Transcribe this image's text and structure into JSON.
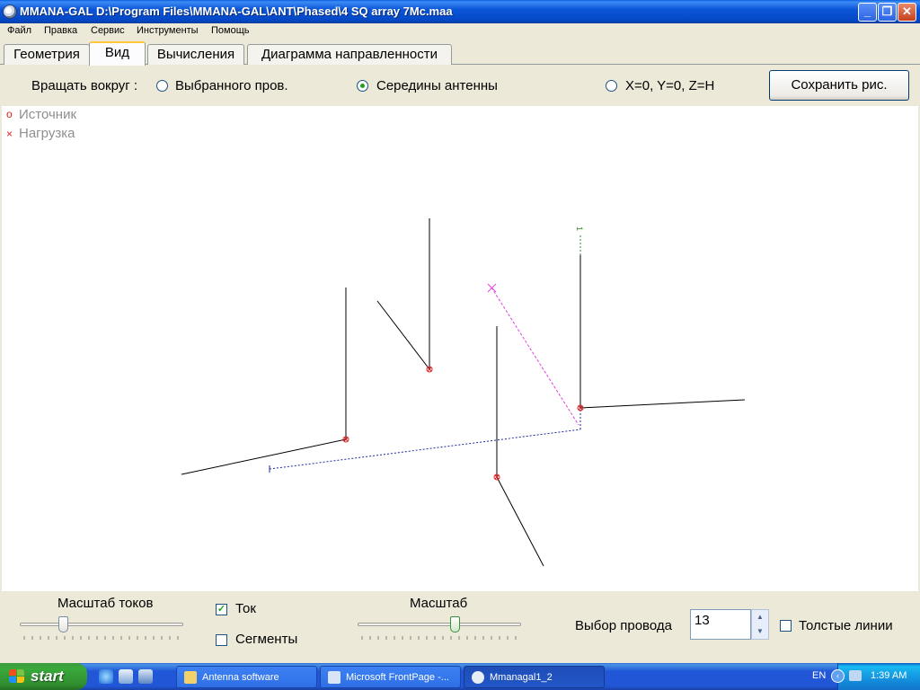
{
  "window": {
    "title": "MMANA-GAL D:\\Program Files\\MMANA-GAL\\ANT\\Phased\\4 SQ array 7Mc.maa",
    "minimize": "_",
    "maximize": "❐",
    "close": "✕"
  },
  "menu": [
    "Файл",
    "Правка",
    "Сервис",
    "Инструменты",
    "Помощь"
  ],
  "tabs": [
    "Геометрия",
    "Вид",
    "Вычисления",
    "Диаграмма направленности"
  ],
  "active_tab": "Вид",
  "options": {
    "rotate_label": "Вращать вокруг :",
    "radio_selected_wire": "Выбранного пров.",
    "radio_antenna_center": "Середины антенны",
    "radio_origin": "X=0, Y=0, Z=H",
    "selected": "Середины антенны",
    "save_button": "Сохранить рис."
  },
  "legend": {
    "source_mark": "o",
    "source": "Источник",
    "load_mark": "×",
    "load": "Нагрузка"
  },
  "view": {
    "label_1": "1"
  },
  "controls": {
    "current_scale_label": "Масштаб токов",
    "current_scale_value": 0.25,
    "current_checkbox": "Ток",
    "current_checked": true,
    "segments_checkbox": "Сегменты",
    "segments_checked": false,
    "scale_label": "Масштаб",
    "scale_value": 0.6,
    "wire_select_label": "Выбор провода",
    "wire_select_value": "13",
    "thick_lines_checkbox": "Толстые линии",
    "thick_lines_checked": false
  },
  "taskbar": {
    "start": "start",
    "tasks": [
      "Antenna software",
      "Microsoft FrontPage -...",
      "Mmanagal1_2"
    ],
    "active_task": "Mmanagal1_2",
    "language": "EN",
    "clock": "1:39 AM"
  },
  "colors": {
    "wire": "#000000",
    "dotted_blue": "#1E2A9C",
    "dotted_magenta": "#E040E0",
    "dotted_green": "#2E8B2E",
    "source_red": "#E02020",
    "accent_green": "#21A121"
  }
}
